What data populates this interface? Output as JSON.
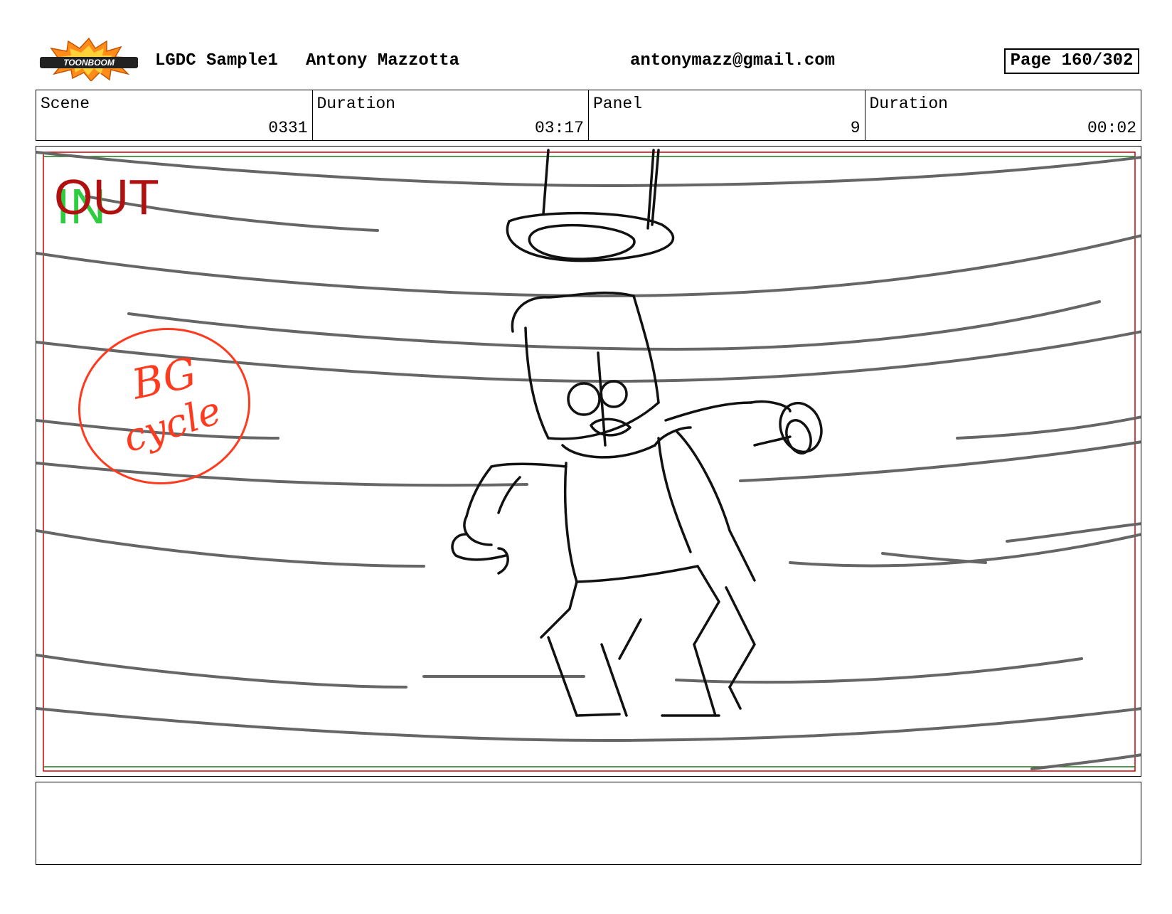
{
  "header": {
    "logo_text": "TOONBOOM",
    "project": "LGDC Sample1",
    "author": "Antony Mazzotta",
    "email": "antonymazz@gmail.com",
    "page": "Page 160/302"
  },
  "info": {
    "scene_label": "Scene",
    "scene_value": "0331",
    "scene_duration_label": "Duration",
    "scene_duration_value": "03:17",
    "panel_label": "Panel",
    "panel_value": "9",
    "panel_duration_label": "Duration",
    "panel_duration_value": "00:02"
  },
  "panel": {
    "in_marker": "IN",
    "out_marker": "OUT",
    "note_line1": "BG",
    "note_line2": "cycle",
    "colors": {
      "in": "#2ecc40",
      "out": "#b01010",
      "note": "#ff3b1f",
      "safe_red": "#cc0000",
      "safe_green": "#1a7a1a"
    }
  },
  "notes": {
    "text": ""
  }
}
